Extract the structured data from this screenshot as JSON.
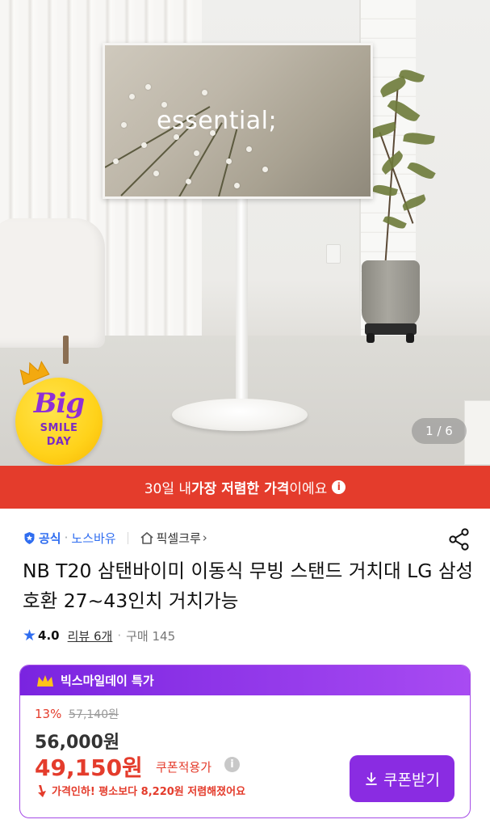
{
  "hero": {
    "tv_text": "essential;",
    "pager": "1 / 6",
    "badge": {
      "big": "Big",
      "smile": "SMILE",
      "day": "DAY"
    }
  },
  "banner": {
    "prefix": "30일 내 ",
    "bold": "가장 저렴한 가격",
    "suffix": "이에요"
  },
  "seller": {
    "official": "공식",
    "brand": "노스바유",
    "store": "픽셀크루",
    "chevron": "›"
  },
  "product": {
    "title": "NB T20 삼탠바이미 이동식 무빙 스탠드 거치대 LG 삼성 호환 27~43인치 거치가능",
    "rating": "4.0",
    "reviews": "리뷰 6개",
    "purchases": "구매 145"
  },
  "price_card": {
    "header": "빅스마일데이 특가",
    "discount_pct": "13%",
    "original_price": "57,140원",
    "sale_price": "56,000원",
    "coupon_price": "49,150원",
    "coupon_note": "쿠폰적용가",
    "price_drop": "가격인하! 평소보다 8,220원 저렴해졌어요",
    "coupon_button": "쿠폰받기"
  },
  "colors": {
    "banner_red": "#e43c2c",
    "accent_blue": "#2f6df0",
    "purple": "#8a2ce2"
  }
}
